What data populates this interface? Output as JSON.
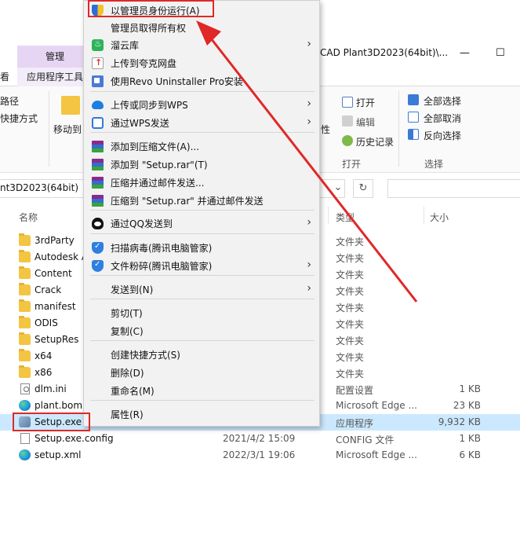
{
  "window": {
    "title_fragment": "CAD Plant3D2023(64bit)\\...",
    "context_tab": "管理",
    "ribbon_tab_left": "看",
    "ribbon_tab_active": "应用程序工具",
    "minimize_glyph": "—",
    "maximize_glyph": "☐"
  },
  "ribbon": {
    "left_path_label": "路径",
    "left_shortcut_label": "快捷方式",
    "move_to": "移动到",
    "open": "打开",
    "edit": "编辑",
    "history": "历史记录",
    "open_group": "打开",
    "select_all": "全部选择",
    "select_none": "全部取消",
    "invert_select": "反向选择",
    "select_group": "选择",
    "attr_fragment": "性"
  },
  "address": {
    "path_fragment": "nt3D2023(64bit)",
    "dropdown_glyph": "⌄",
    "refresh_glyph": "↻"
  },
  "columns": {
    "name": "名称",
    "type": "类型",
    "size": "大小"
  },
  "files": [
    {
      "name": "3rdParty",
      "date": "",
      "type": "文件夹",
      "size": "",
      "icon": "folder-icon"
    },
    {
      "name": "Autodesk A",
      "date": "",
      "type": "文件夹",
      "size": "",
      "icon": "folder-icon"
    },
    {
      "name": "Content",
      "date": "",
      "type": "文件夹",
      "size": "",
      "icon": "folder-icon"
    },
    {
      "name": "Crack",
      "date": "",
      "type": "文件夹",
      "size": "",
      "icon": "folder-icon"
    },
    {
      "name": "manifest",
      "date": "",
      "type": "文件夹",
      "size": "",
      "icon": "folder-icon"
    },
    {
      "name": "ODIS",
      "date": "",
      "type": "文件夹",
      "size": "",
      "icon": "folder-icon"
    },
    {
      "name": "SetupRes",
      "date": "",
      "type": "文件夹",
      "size": "",
      "icon": "folder-icon"
    },
    {
      "name": "x64",
      "date": "",
      "type": "文件夹",
      "size": "",
      "icon": "folder-icon"
    },
    {
      "name": "x86",
      "date": "",
      "type": "文件夹",
      "size": "",
      "icon": "folder-icon"
    },
    {
      "name": "dlm.ini",
      "date": "",
      "type": "配置设置",
      "size": "1 KB",
      "icon": "ini-file-icon"
    },
    {
      "name": "plant.bom.",
      "date": "",
      "type": "Microsoft Edge ...",
      "size": "23 KB",
      "icon": "edge-icon"
    },
    {
      "name": "Setup.exe",
      "date": "",
      "type": "应用程序",
      "size": "9,932 KB",
      "icon": "setup-exe-icon"
    },
    {
      "name": "Setup.exe.config",
      "date": "2021/4/2 15:09",
      "type": "CONFIG 文件",
      "size": "1 KB",
      "icon": "config-file-icon"
    },
    {
      "name": "setup.xml",
      "date": "2022/3/1 19:06",
      "type": "Microsoft Edge ...",
      "size": "6 KB",
      "icon": "edge-icon"
    }
  ],
  "context_menu": {
    "items": [
      {
        "label": "以管理员身份运行(A)",
        "icon": "uac-shield-icon",
        "submenu": false
      },
      {
        "label": "管理员取得所有权",
        "icon": "",
        "submenu": false
      },
      {
        "label": "溜云库",
        "icon": "cloud-library-icon",
        "submenu": true
      },
      {
        "label": "上传到夸克网盘",
        "icon": "quark-upload-icon",
        "submenu": false
      },
      {
        "label": "使用Revo Uninstaller Pro安装",
        "icon": "revo-uninstaller-icon",
        "submenu": false
      },
      {
        "label": "上传或同步到WPS",
        "icon": "wps-cloud-icon",
        "submenu": true
      },
      {
        "label": "通过WPS发送",
        "icon": "wps-share-icon",
        "submenu": true
      },
      {
        "label": "添加到压缩文件(A)...",
        "icon": "winrar-icon",
        "submenu": false
      },
      {
        "label": "添加到 \"Setup.rar\"(T)",
        "icon": "winrar-icon",
        "submenu": false
      },
      {
        "label": "压缩并通过邮件发送...",
        "icon": "winrar-icon",
        "submenu": false
      },
      {
        "label": "压缩到 \"Setup.rar\" 并通过邮件发送",
        "icon": "winrar-icon",
        "submenu": false
      },
      {
        "label": "通过QQ发送到",
        "icon": "qq-icon",
        "submenu": true
      },
      {
        "label": "扫描病毒(腾讯电脑管家)",
        "icon": "tencent-pc-manager-icon",
        "submenu": false
      },
      {
        "label": "文件粉碎(腾讯电脑管家)",
        "icon": "tencent-pc-manager-icon",
        "submenu": true
      },
      {
        "label": "发送到(N)",
        "icon": "",
        "submenu": true
      },
      {
        "label": "剪切(T)",
        "icon": "",
        "submenu": false
      },
      {
        "label": "复制(C)",
        "icon": "",
        "submenu": false
      },
      {
        "label": "创建快捷方式(S)",
        "icon": "",
        "submenu": false
      },
      {
        "label": "删除(D)",
        "icon": "",
        "submenu": false
      },
      {
        "label": "重命名(M)",
        "icon": "",
        "submenu": false
      },
      {
        "label": "属性(R)",
        "icon": "",
        "submenu": false
      }
    ],
    "submenu_arrow": "›"
  },
  "annotation": {
    "highlight_color": "#e02828"
  }
}
